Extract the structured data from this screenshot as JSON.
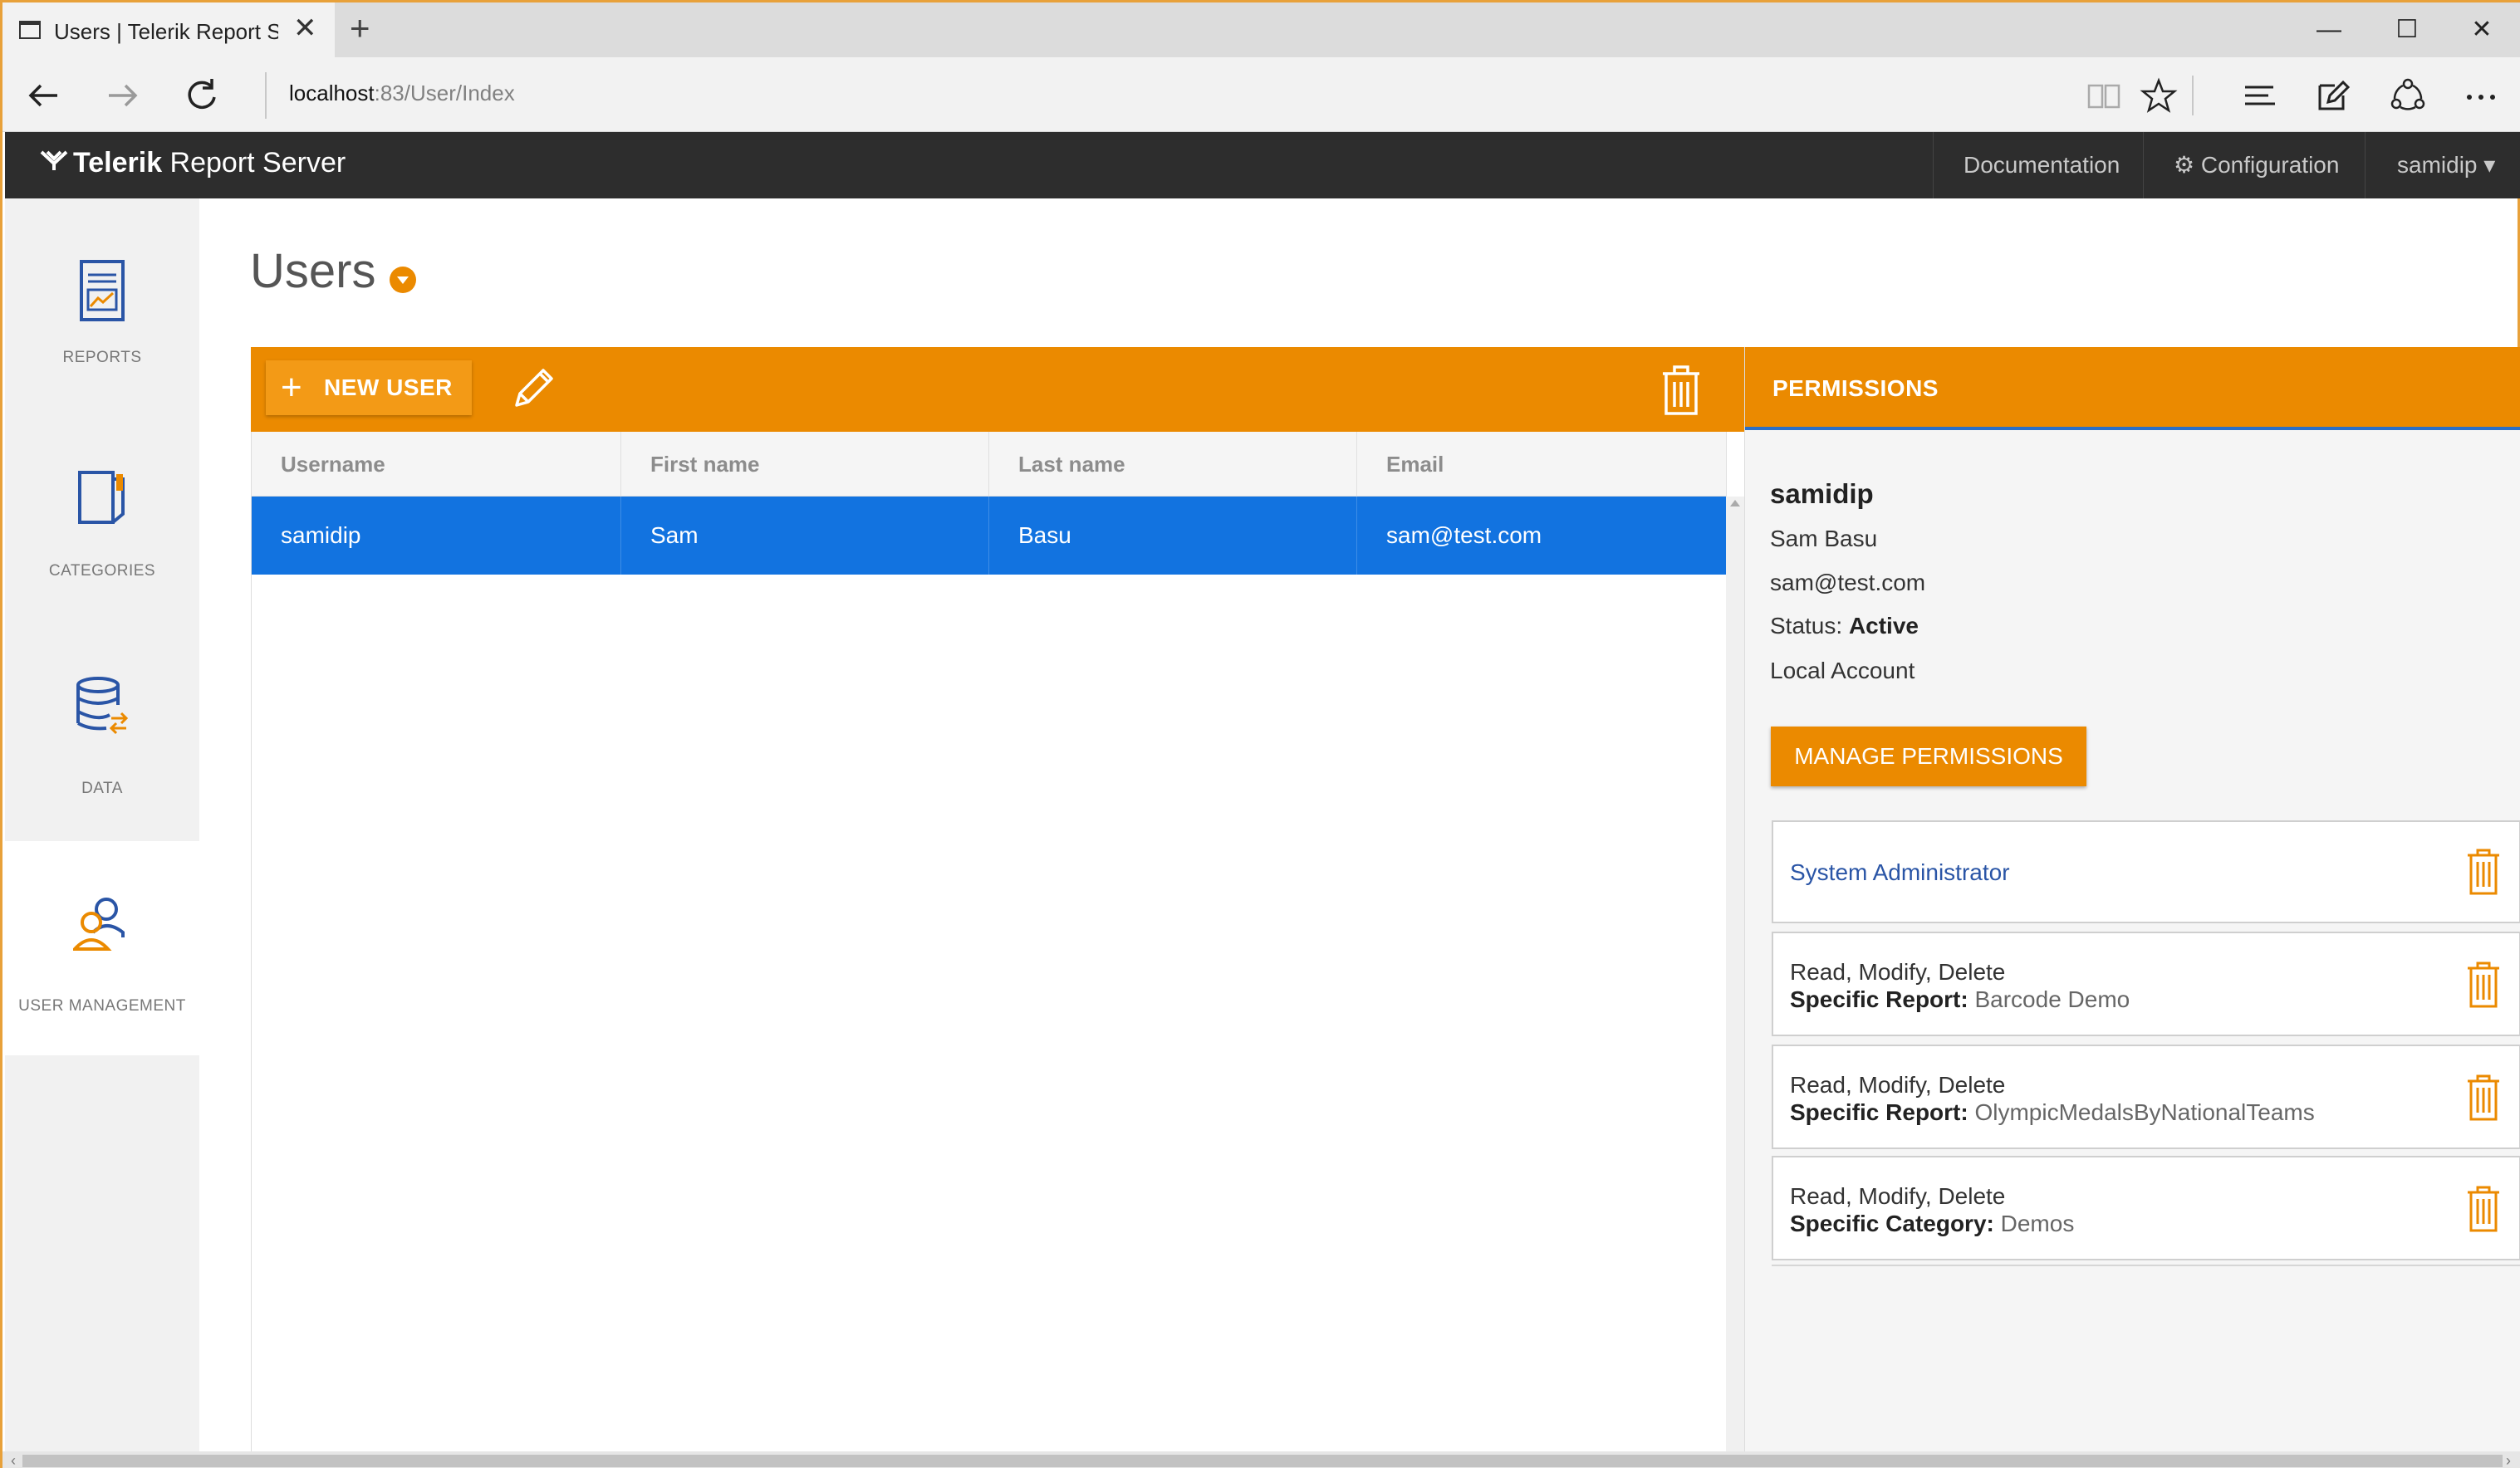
{
  "browser": {
    "tab_title": "Users | Telerik Report Se",
    "new_tab": "+",
    "tab_close": "✕",
    "address_host": "localhost",
    "address_path": ":83/User/Index",
    "window_minimize": "—",
    "window_maximize": "☐",
    "window_close": "✕"
  },
  "app": {
    "brand_bold": "Telerik",
    "brand_rest": " Report Server",
    "nav": {
      "documentation": "Documentation",
      "configuration": "Configuration",
      "user": "samidip"
    }
  },
  "sidebar": {
    "items": [
      {
        "label": "REPORTS",
        "icon": "report-document-icon"
      },
      {
        "label": "CATEGORIES",
        "icon": "categories-icon"
      },
      {
        "label": "DATA",
        "icon": "database-icon"
      },
      {
        "label": "USER MANAGEMENT",
        "icon": "users-icon"
      }
    ]
  },
  "main": {
    "title": "Users",
    "toolbar": {
      "new_user_label": "NEW USER"
    },
    "grid": {
      "columns": [
        "Username",
        "First name",
        "Last name",
        "Email"
      ],
      "rows": [
        [
          "samidip",
          "Sam",
          "Basu",
          "sam@test.com"
        ]
      ]
    }
  },
  "permissions": {
    "header": "PERMISSIONS",
    "username": "samidip",
    "full_name": "Sam Basu",
    "email": "sam@test.com",
    "status_label": "Status: ",
    "status_value": "Active",
    "account_type": "Local Account",
    "manage_button": "MANAGE PERMISSIONS",
    "entries": [
      {
        "line1": "System Administrator",
        "line2_label": "",
        "line2_value": ""
      },
      {
        "line1": "Read, Modify, Delete",
        "line2_label": "Specific Report:",
        "line2_value": "Barcode Demo"
      },
      {
        "line1": "Read, Modify, Delete",
        "line2_label": "Specific Report:",
        "line2_value": "OlympicMedalsByNationalTeams"
      },
      {
        "line1": "Read, Modify, Delete",
        "line2_label": "Specific Category:",
        "line2_value": "Demos"
      }
    ]
  },
  "colors": {
    "accent_orange": "#eb8a00",
    "selection_blue": "#1273e0",
    "header_dark": "#2d2d2d",
    "link_blue": "#2a55a6"
  }
}
